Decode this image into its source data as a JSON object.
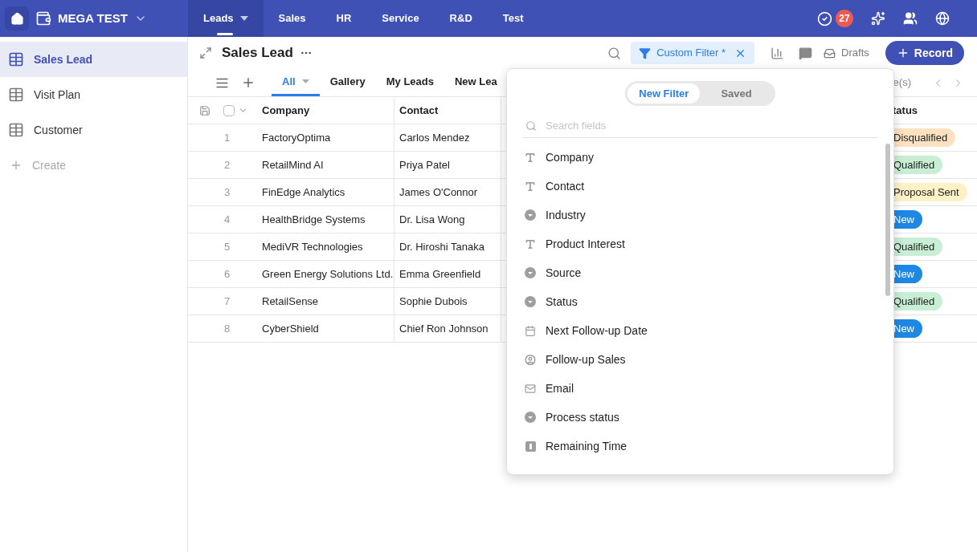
{
  "topbar": {
    "app_name": "MEGA TEST",
    "nav": [
      {
        "label": "Leads",
        "selected": true
      },
      {
        "label": "Sales",
        "selected": false
      },
      {
        "label": "HR",
        "selected": false
      },
      {
        "label": "Service",
        "selected": false
      },
      {
        "label": "R&D",
        "selected": false
      },
      {
        "label": "Test",
        "selected": false
      }
    ],
    "task_count": "27"
  },
  "sidebar": {
    "items": [
      {
        "label": "Sales Lead",
        "selected": true
      },
      {
        "label": "Visit Plan",
        "selected": false
      },
      {
        "label": "Customer",
        "selected": false
      }
    ],
    "create": "Create"
  },
  "header": {
    "title": "Sales Lead",
    "filter": "Custom Filter *",
    "drafts": "Drafts",
    "record_button": "Record"
  },
  "views": {
    "tabs": [
      {
        "label": "All",
        "selected": true
      },
      {
        "label": "Gallery",
        "selected": false
      },
      {
        "label": "My Leads",
        "selected": false
      },
      {
        "label": "New Lea",
        "selected": false
      }
    ],
    "right_text": "e(s)"
  },
  "table": {
    "select_all": {
      "checked": false
    },
    "columns": [
      "Company",
      "Contact",
      "tatus"
    ],
    "rows": [
      {
        "index": "1",
        "company": "FactoryOptima",
        "contact": "Carlos Mendez",
        "status": {
          "label": "Disqualified",
          "color": "#fde2c2"
        }
      },
      {
        "index": "2",
        "company": "RetailMind AI",
        "contact": "Priya Patel",
        "status": {
          "label": "Qualified",
          "color": "#c8efd6"
        }
      },
      {
        "index": "3",
        "company": "FinEdge Analytics",
        "contact": "James O'Connor",
        "status": {
          "label": "Proposal Sent",
          "color": "#fdf2c6"
        }
      },
      {
        "index": "4",
        "company": "HealthBridge Systems",
        "contact": "Dr. Lisa Wong",
        "status": {
          "label": "New",
          "color": "#1e88e5"
        }
      },
      {
        "index": "5",
        "company": "MediVR Technologies",
        "contact": "Dr. Hiroshi Tanaka",
        "status": {
          "label": "Qualified",
          "color": "#c8efd6"
        }
      },
      {
        "index": "6",
        "company": "Green Energy Solutions Ltd.",
        "contact": "Emma Greenfield",
        "status": {
          "label": "New",
          "color": "#1e88e5"
        }
      },
      {
        "index": "7",
        "company": "RetailSense",
        "contact": "Sophie Dubois",
        "status": {
          "label": "Qualified",
          "color": "#c8efd6"
        }
      },
      {
        "index": "8",
        "company": "CyberShield",
        "contact": "Chief Ron Johnson",
        "status": {
          "label": "New",
          "color": "#1e88e5"
        }
      }
    ]
  },
  "filter_popup": {
    "modes": [
      {
        "label": "New Filter",
        "selected": true
      },
      {
        "label": "Saved",
        "selected": false
      }
    ],
    "search": {
      "placeholder": "Search fields"
    },
    "fields": [
      {
        "label": "Company",
        "kind": "text"
      },
      {
        "label": "Contact",
        "kind": "text"
      },
      {
        "label": "Industry",
        "kind": "select"
      },
      {
        "label": "Product Interest",
        "kind": "text"
      },
      {
        "label": "Source",
        "kind": "select"
      },
      {
        "label": "Status",
        "kind": "select"
      },
      {
        "label": "Next Follow-up Date",
        "kind": "date"
      },
      {
        "label": "Follow-up Sales",
        "kind": "user"
      },
      {
        "label": "Email",
        "kind": "email"
      },
      {
        "label": "Process status",
        "kind": "select"
      },
      {
        "label": "Remaining Time",
        "kind": "number"
      }
    ]
  }
}
